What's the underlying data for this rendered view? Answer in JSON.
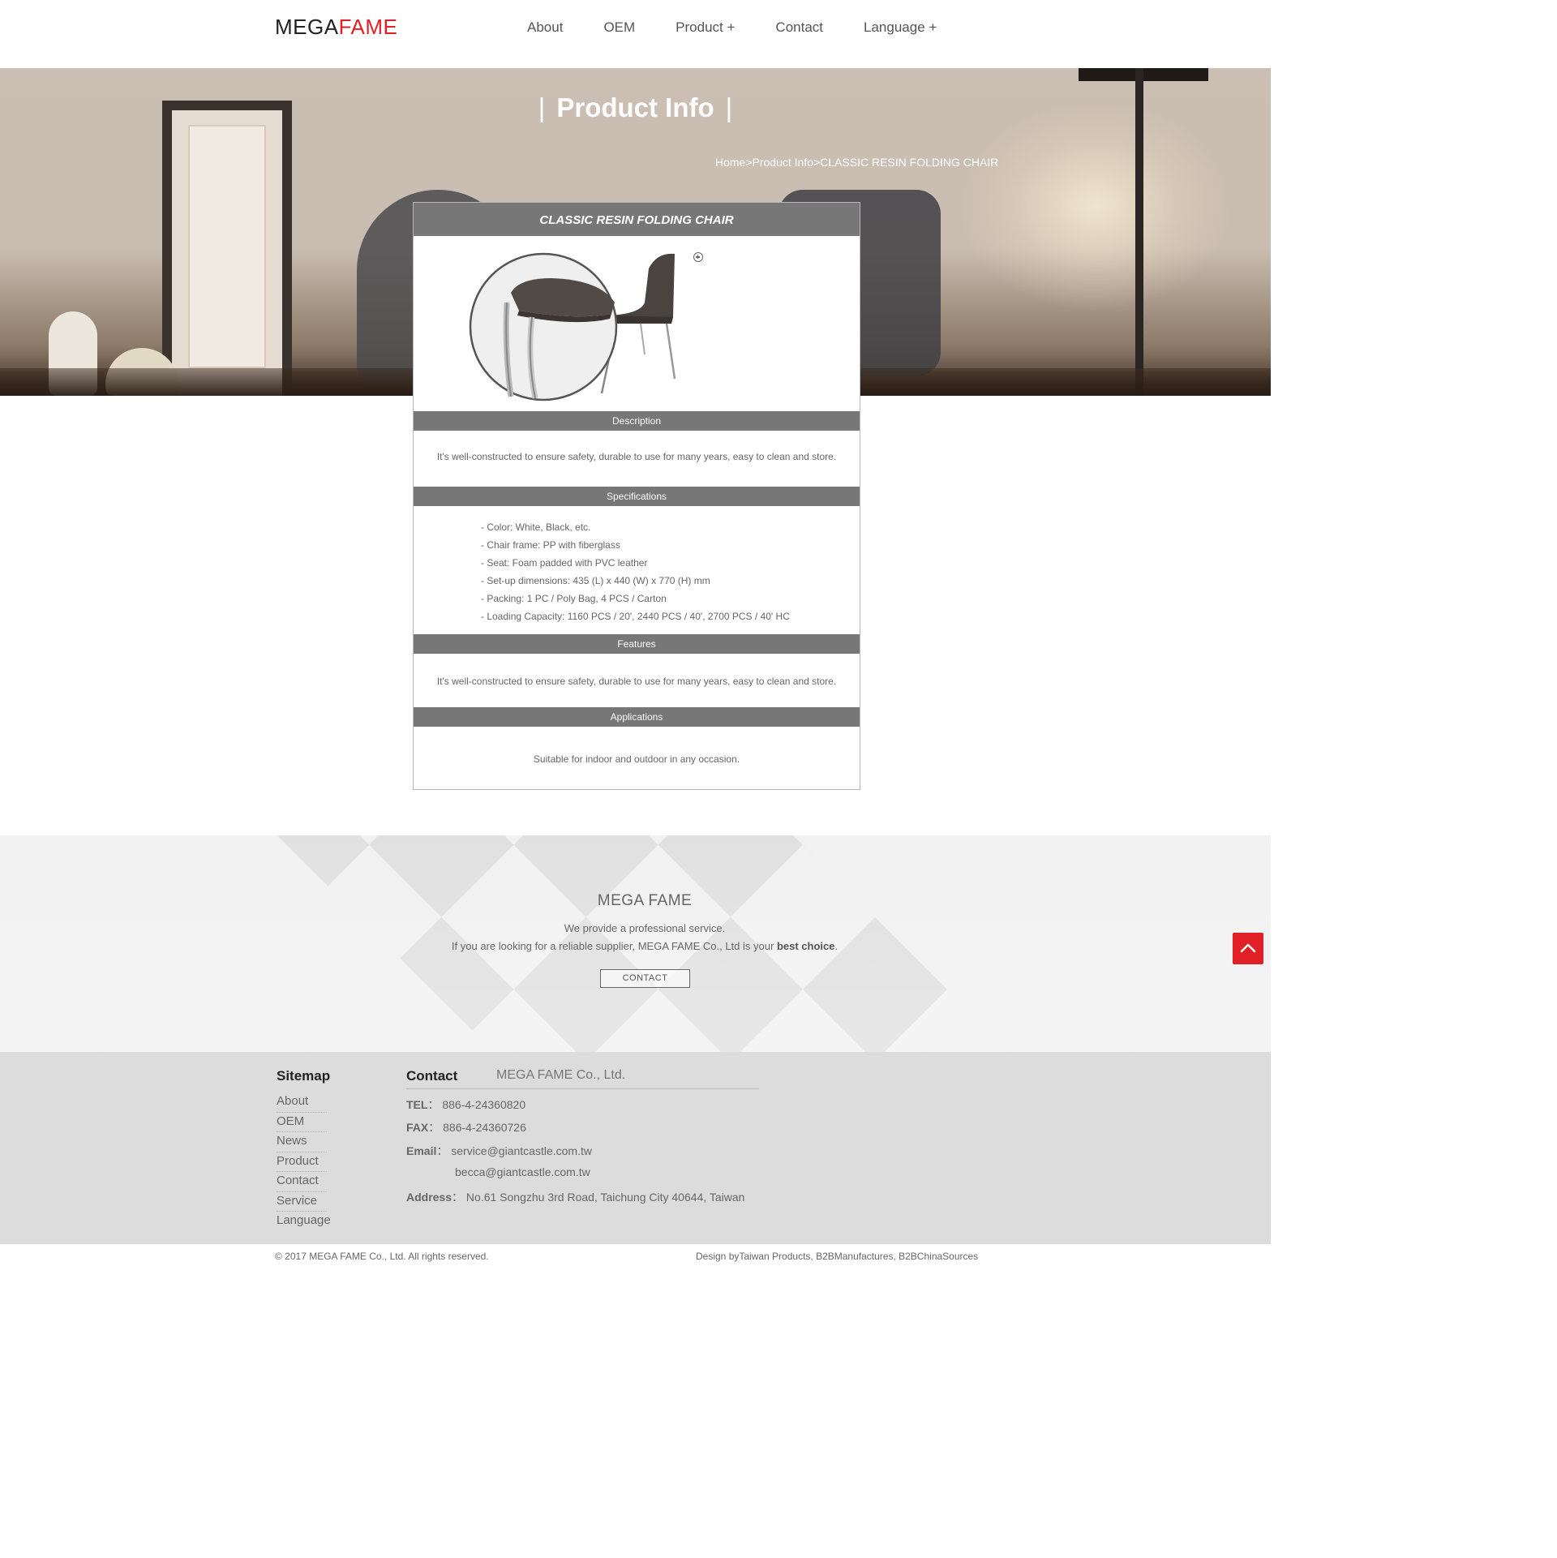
{
  "header": {
    "logo_part1": "MEGA",
    "logo_part2": "FAME",
    "nav": [
      "About",
      "OEM",
      "Product +",
      "Contact",
      "Language +"
    ]
  },
  "banner": {
    "title": "Product Info",
    "title_bar_left": "|",
    "title_bar_right": "|",
    "breadcrumb": "Home>Product Info>CLASSIC RESIN FOLDING CHAIR"
  },
  "product": {
    "name": "CLASSIC RESIN FOLDING CHAIR",
    "zoom_icon": "zoom-in-icon",
    "sections": {
      "description_label": "Description",
      "description_text": "It's well-constructed to ensure safety, durable to use for many years, easy to clean and store.",
      "specifications_label": "Specifications",
      "specifications": [
        "- Color: White, Black, etc.",
        "- Chair frame: PP with fiberglass",
        "- Seat: Foam padded with PVC leather",
        "- Set-up dimensions: 435 (L) x 440 (W) x 770 (H) mm",
        "- Packing: 1 PC / Poly Bag, 4 PCS / Carton",
        "- Loading Capacity: 1160 PCS / 20', 2440 PCS / 40', 2700 PCS / 40' HC"
      ],
      "features_label": "Features",
      "features_text": "It's well-constructed to ensure safety, durable to use for many years, easy to clean and store.",
      "applications_label": "Applications",
      "applications_text": "Suitable for indoor and outdoor in any occasion."
    }
  },
  "promo": {
    "title": "MEGA FAME",
    "line1": "We provide a professional service.",
    "line2_prefix": "If you are looking for a reliable supplier, MEGA FAME Co., Ltd is your ",
    "line2_bold": "best choice",
    "line2_suffix": ".",
    "button": "CONTACT"
  },
  "footer": {
    "sitemap_title": "Sitemap",
    "sitemap": [
      "About",
      "OEM",
      "News",
      "Product",
      "Contact",
      "Service",
      "Language"
    ],
    "contact_title": "Contact",
    "company": "MEGA FAME Co., Ltd.",
    "tel_label": "TEL",
    "tel": "886-4-24360820",
    "fax_label": "FAX",
    "fax": "886-4-24360726",
    "email_label": "Email",
    "email1": "service@giantcastle.com.tw",
    "email2": "becca@giantcastle.com.tw",
    "address_label": "Address",
    "address": "No.61 Songzhu 3rd Road, Taichung City 40644, Taiwan",
    "separator": "："
  },
  "bottom": {
    "copyright": "© 2017 MEGA FAME Co., Ltd. All rights reserved.",
    "design_by": "Design byTaiwan Products, B2BManufactures, B2BChinaSources"
  },
  "colors": {
    "accent": "#e01f26",
    "section_bar": "#777777",
    "footer_bg": "#dcdcdc"
  },
  "icons": {
    "back_to_top": "chevron-up-icon"
  }
}
